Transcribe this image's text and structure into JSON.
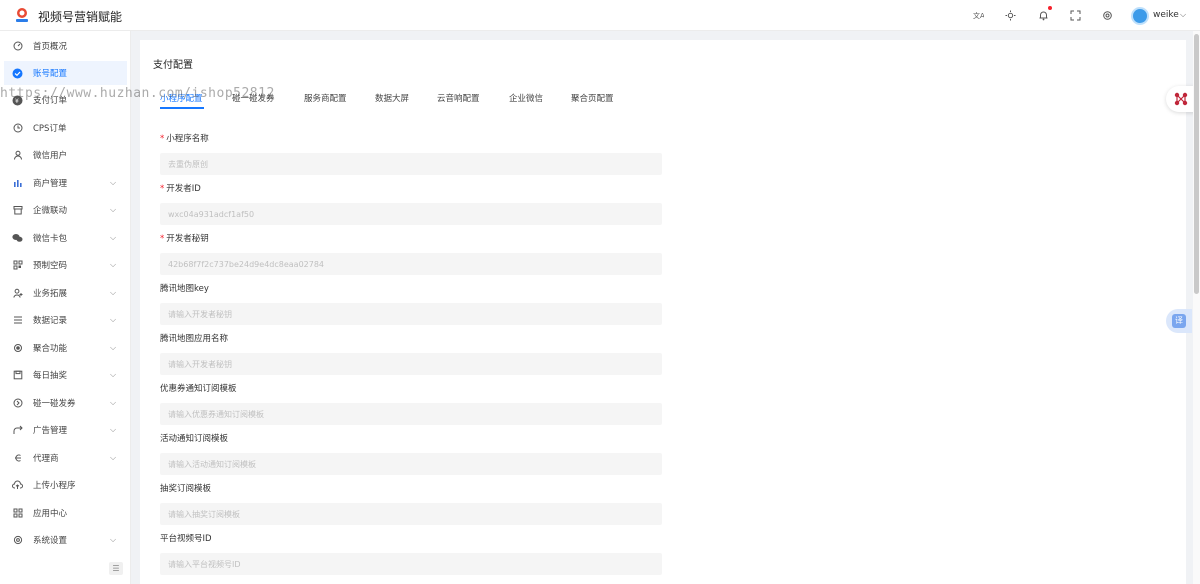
{
  "app": {
    "title": "视频号营销赋能"
  },
  "header": {
    "icons": [
      "translate-icon",
      "theme-icon",
      "bell-icon",
      "fullscreen-icon",
      "settings-icon"
    ],
    "user": {
      "name": "weike"
    }
  },
  "sidebar": {
    "items": [
      {
        "label": "首页概况",
        "icon": "dashboard-icon",
        "has_children": false,
        "active": false
      },
      {
        "label": "账号配置",
        "icon": "account-config-icon",
        "has_children": false,
        "active": true
      },
      {
        "label": "支付订单",
        "icon": "payment-order-icon",
        "has_children": false,
        "active": false
      },
      {
        "label": "CPS订单",
        "icon": "clock-icon",
        "has_children": false,
        "active": false
      },
      {
        "label": "微信用户",
        "icon": "user-icon",
        "has_children": false,
        "active": false
      },
      {
        "label": "商户管理",
        "icon": "bar-chart-icon",
        "has_children": true,
        "active": false
      },
      {
        "label": "企微联动",
        "icon": "archive-icon",
        "has_children": true,
        "active": false
      },
      {
        "label": "微信卡包",
        "icon": "wechat-icon",
        "has_children": true,
        "active": false
      },
      {
        "label": "预制空码",
        "icon": "qrcode-icon",
        "has_children": true,
        "active": false
      },
      {
        "label": "业务拓展",
        "icon": "user-add-icon",
        "has_children": true,
        "active": false
      },
      {
        "label": "数据记录",
        "icon": "list-icon",
        "has_children": true,
        "active": false
      },
      {
        "label": "聚合功能",
        "icon": "aggregate-icon",
        "has_children": true,
        "active": false
      },
      {
        "label": "每日抽奖",
        "icon": "save-icon",
        "has_children": true,
        "active": false
      },
      {
        "label": "碰一碰发券",
        "icon": "circle-arrow-icon",
        "has_children": true,
        "active": false
      },
      {
        "label": "广告管理",
        "icon": "share-icon",
        "has_children": true,
        "active": false
      },
      {
        "label": "代理商",
        "icon": "agent-icon",
        "has_children": true,
        "active": false
      },
      {
        "label": "上传小程序",
        "icon": "cloud-upload-icon",
        "has_children": false,
        "active": false
      },
      {
        "label": "应用中心",
        "icon": "apps-icon",
        "has_children": false,
        "active": false
      },
      {
        "label": "系统设置",
        "icon": "gear-icon",
        "has_children": true,
        "active": false
      }
    ]
  },
  "main": {
    "title": "支付配置",
    "watermark": "https://www.huzhan.com/ishop52812",
    "tabs": [
      {
        "label": "小程序配置",
        "active": true
      },
      {
        "label": "碰一碰发券",
        "active": false
      },
      {
        "label": "服务商配置",
        "active": false
      },
      {
        "label": "数据大屏",
        "active": false
      },
      {
        "label": "云音响配置",
        "active": false
      },
      {
        "label": "企业微信",
        "active": false
      },
      {
        "label": "聚合页配置",
        "active": false
      }
    ],
    "fields": [
      {
        "label": "小程序名称",
        "required": true,
        "value": "去重伪原创"
      },
      {
        "label": "开发者ID",
        "required": true,
        "value": "wxc04a931adcf1af50"
      },
      {
        "label": "开发者秘钥",
        "required": true,
        "value": "42b68f7f2c737be24d9e4dc8eaa02784"
      },
      {
        "label": "腾讯地图key",
        "required": false,
        "placeholder": "请输入开发者秘钥"
      },
      {
        "label": "腾讯地图应用名称",
        "required": false,
        "placeholder": "请输入开发者秘钥"
      },
      {
        "label": "优惠券通知订阅模板",
        "required": false,
        "placeholder": "请输入优惠券通知订阅模板"
      },
      {
        "label": "活动通知订阅模板",
        "required": false,
        "placeholder": "请输入活动通知订阅模板"
      },
      {
        "label": "抽奖订阅模板",
        "required": false,
        "placeholder": "请输入抽奖订阅模板"
      },
      {
        "label": "平台视频号ID",
        "required": false,
        "placeholder": "请输入平台视频号ID"
      }
    ]
  },
  "floating": {
    "translate_label": "译"
  },
  "colors": {
    "accent": "#1677ff",
    "required": "#f5222d",
    "input_bg": "#f5f5f5"
  }
}
